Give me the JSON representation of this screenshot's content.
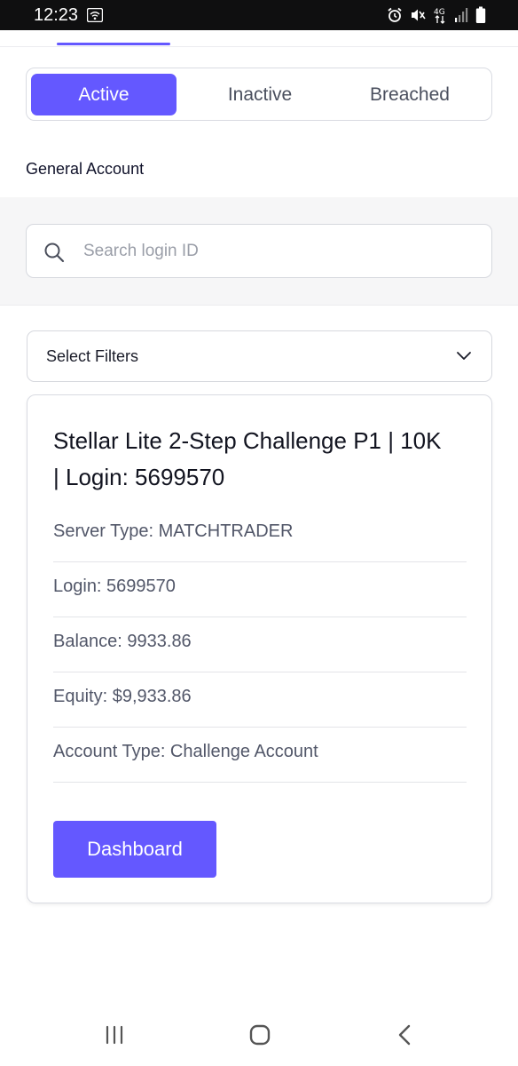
{
  "status_bar": {
    "time": "12:23",
    "network": "4G"
  },
  "tabs": {
    "items": [
      {
        "label": "Active",
        "active": true
      },
      {
        "label": "Inactive",
        "active": false
      },
      {
        "label": "Breached",
        "active": false
      }
    ]
  },
  "section_title": "General Account",
  "search": {
    "placeholder": "Search login ID",
    "value": ""
  },
  "filters": {
    "label": "Select Filters"
  },
  "account_card": {
    "title": "Stellar Lite 2-Step Challenge P1 | 10K | Login: 5699570",
    "rows": [
      {
        "text": "Server Type: MATCHTRADER"
      },
      {
        "text": "Login: 5699570"
      },
      {
        "text": "Balance: 9933.86"
      },
      {
        "text": "Equity: $9,933.86"
      },
      {
        "text": "Account Type: Challenge Account"
      }
    ],
    "button_label": "Dashboard"
  },
  "icons": {
    "search": "search-icon",
    "filter_toggle": "chevron-down-icon",
    "nav_recents": "recents-icon",
    "nav_home": "home-icon",
    "nav_back": "back-icon"
  },
  "colors": {
    "accent": "#6458ff",
    "status_bar": "#0f0f10",
    "band_background": "#f6f6f7"
  }
}
